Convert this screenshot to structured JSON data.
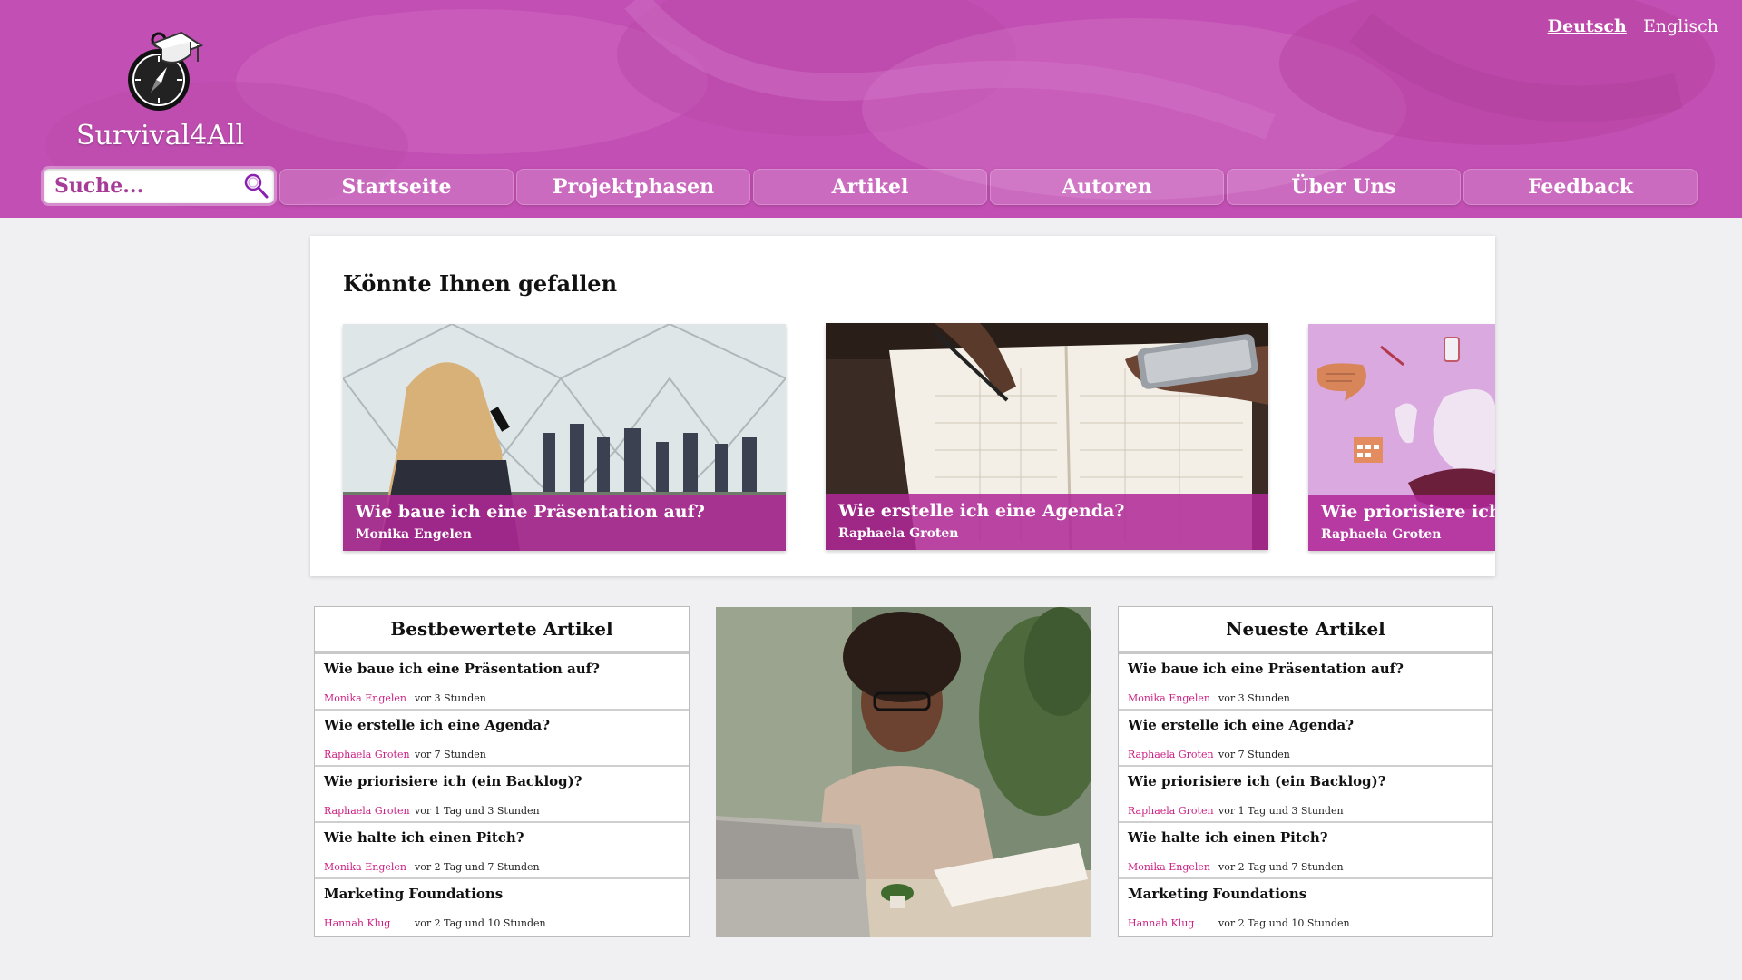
{
  "header": {
    "brand": "Survival4All",
    "languages": [
      {
        "label": "Deutsch",
        "active": true
      },
      {
        "label": "Englisch",
        "active": false
      }
    ],
    "search_placeholder": "Suche...",
    "nav": [
      "Startseite",
      "Projektphasen",
      "Artikel",
      "Autoren",
      "Über Uns",
      "Feedback"
    ]
  },
  "suggestions": {
    "title": "Könnte Ihnen gefallen",
    "cards": [
      {
        "title": "Wie baue ich eine Präsentation auf?",
        "author": "Monika Engelen"
      },
      {
        "title": "Wie erstelle ich eine Agenda?",
        "author": "Raphaela Groten"
      },
      {
        "title": "Wie priorisiere ich (ein Backlog)?",
        "author": "Raphaela Groten"
      }
    ]
  },
  "top_rated": {
    "title": "Bestbewertete Artikel",
    "items": [
      {
        "title": "Wie baue ich eine Präsentation auf?",
        "author": "Monika Engelen",
        "time": "vor 3 Stunden"
      },
      {
        "title": "Wie erstelle ich eine Agenda?",
        "author": "Raphaela Groten",
        "time": "vor 7 Stunden"
      },
      {
        "title": "Wie priorisiere ich (ein Backlog)?",
        "author": "Raphaela Groten",
        "time": "vor 1 Tag und 3 Stunden"
      },
      {
        "title": "Wie halte ich einen Pitch?",
        "author": "Monika Engelen",
        "time": "vor 2 Tag und 7 Stunden"
      },
      {
        "title": "Marketing Foundations",
        "author": "Hannah Klug",
        "time": "vor 2 Tag und 10 Stunden"
      }
    ]
  },
  "newest": {
    "title": "Neueste Artikel",
    "items": [
      {
        "title": "Wie baue ich eine Präsentation auf?",
        "author": "Monika Engelen",
        "time": "vor 3 Stunden"
      },
      {
        "title": "Wie erstelle ich eine Agenda?",
        "author": "Raphaela Groten",
        "time": "vor 7 Stunden"
      },
      {
        "title": "Wie priorisiere ich (ein Backlog)?",
        "author": "Raphaela Groten",
        "time": "vor 1 Tag und 3 Stunden"
      },
      {
        "title": "Wie halte ich einen Pitch?",
        "author": "Monika Engelen",
        "time": "vor 2 Tag und 7 Stunden"
      },
      {
        "title": "Marketing Foundations",
        "author": "Hannah Klug",
        "time": "vor 2 Tag und 10 Stunden"
      }
    ]
  },
  "colors": {
    "brand": "#c24fb3",
    "caption": "#b02896",
    "author_link": "#cc1f83"
  }
}
